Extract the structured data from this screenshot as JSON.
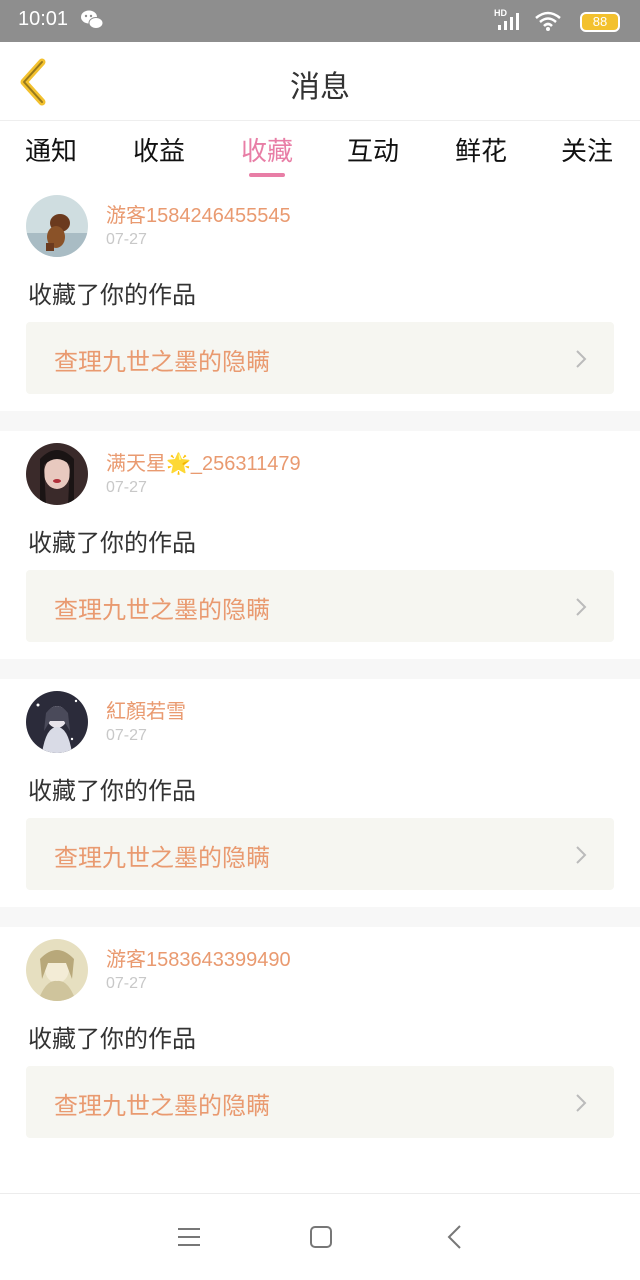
{
  "status_bar": {
    "time": "10:01",
    "network": "HD",
    "battery": "88"
  },
  "header": {
    "title": "消息"
  },
  "tabs": [
    {
      "label": "通知",
      "active": false
    },
    {
      "label": "收益",
      "active": false
    },
    {
      "label": "收藏",
      "active": true
    },
    {
      "label": "互动",
      "active": false
    },
    {
      "label": "鲜花",
      "active": false
    },
    {
      "label": "关注",
      "active": false
    }
  ],
  "messages": [
    {
      "username": "游客1584246455545",
      "date": "07-27",
      "action": "收藏了你的作品",
      "work_title": "查理九世之墨的隐瞒"
    },
    {
      "username": "满天星🌟_256311479",
      "date": "07-27",
      "action": "收藏了你的作品",
      "work_title": "查理九世之墨的隐瞒"
    },
    {
      "username": "紅顏若雪",
      "date": "07-27",
      "action": "收藏了你的作品",
      "work_title": "查理九世之墨的隐瞒"
    },
    {
      "username": "游客1583643399490",
      "date": "07-27",
      "action": "收藏了你的作品",
      "work_title": "查理九世之墨的隐瞒"
    }
  ],
  "colors": {
    "accent_pink": "#e87ea6",
    "username_orange": "#e99a70",
    "back_arrow_yellow": "#f3c12e",
    "status_bar_gray": "#8e8e8e"
  },
  "icons": {
    "back": "chevron-left-icon",
    "work_link": "chevron-right-icon",
    "nav_menu": "menu-icon",
    "nav_home": "square-icon",
    "nav_back": "back-icon"
  }
}
